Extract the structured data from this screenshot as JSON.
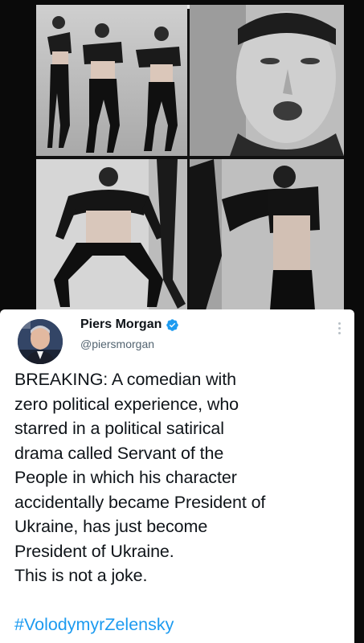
{
  "collage": {
    "panels": [
      {
        "name": "three-dancers-in-heels",
        "icon": "photo"
      },
      {
        "name": "face-close-up",
        "icon": "photo"
      },
      {
        "name": "dancer-crouching-pose",
        "icon": "photo"
      },
      {
        "name": "dancer-side-pose",
        "icon": "photo"
      }
    ]
  },
  "tweet": {
    "display_name": "Piers Morgan",
    "handle": "@piersmorgan",
    "verified": true,
    "verified_color": "#1d9bf0",
    "body": "BREAKING: A comedian with\nzero political experience, who\nstarred in a political satirical\ndrama called Servant of the\nPeople in which his character\naccidentally became President of\nUkraine, has just become\nPresident of Ukraine.\nThis is not a joke.",
    "hashtag": "#VolodymyrZelensky",
    "hashtag_color": "#1d9bf0"
  }
}
